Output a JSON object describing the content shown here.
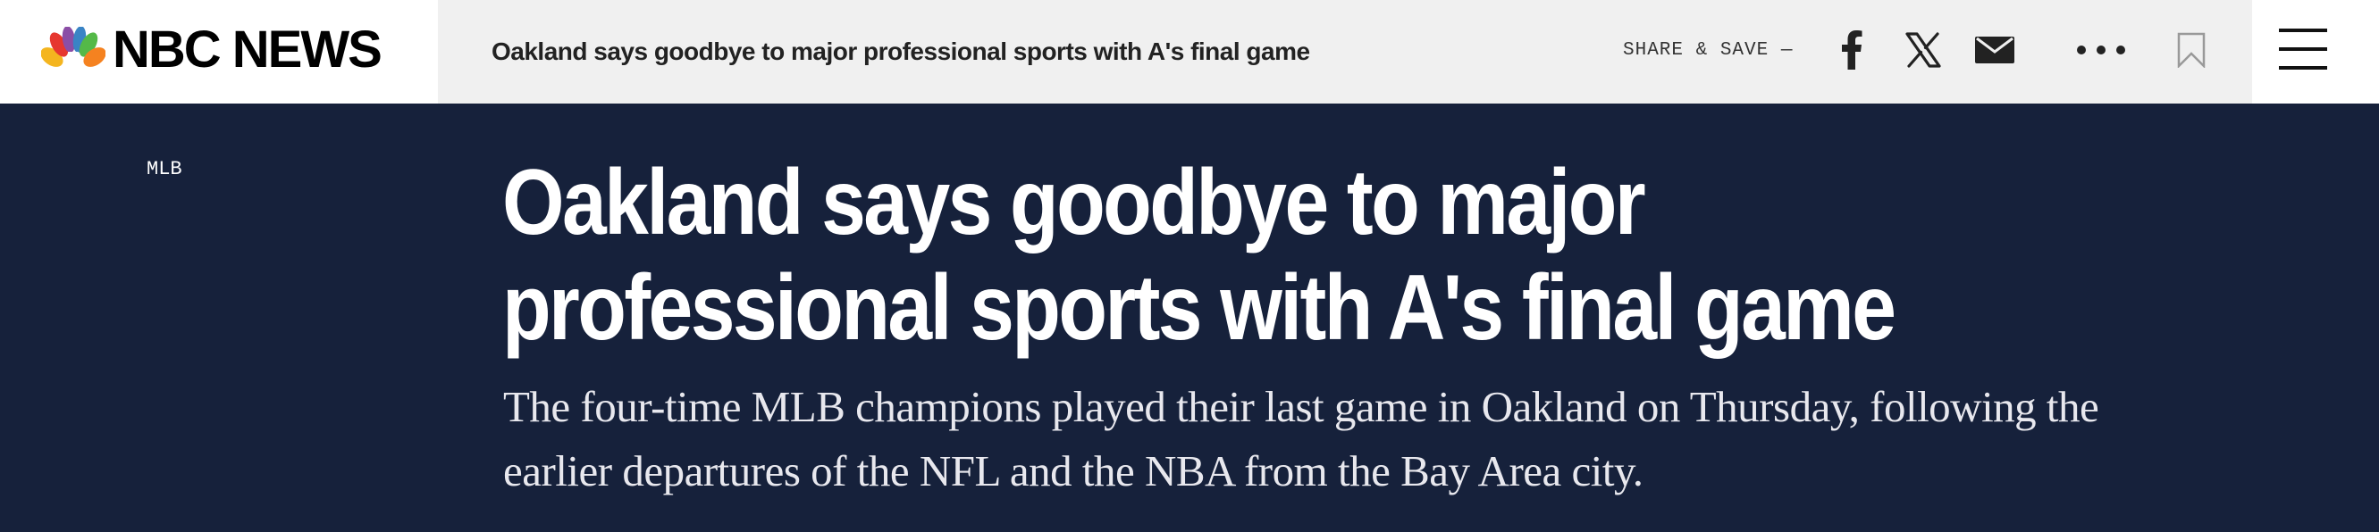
{
  "brand": {
    "logo_text": "NBC NEWS",
    "peacock_colors": [
      "#f4b51f",
      "#e6372f",
      "#8b4ea6",
      "#3a84c5",
      "#54b948",
      "#f58220"
    ]
  },
  "header": {
    "story_title": "Oakland says goodbye to major professional sports with A's final game",
    "share_label": "SHARE & SAVE —",
    "icons": [
      "facebook-icon",
      "x-icon",
      "email-icon",
      "more-icon",
      "bookmark-icon",
      "menu-icon"
    ]
  },
  "article": {
    "section": "MLB",
    "title": "Oakland says goodbye to major professional sports with A's final game",
    "dek": "The four-time MLB champions played their last game in Oakland on Thursday, following the earlier departures of the NFL and the NBA from the Bay Area city."
  },
  "colors": {
    "hero_background": "#16213b",
    "topbar_background": "#f0f0f0"
  }
}
